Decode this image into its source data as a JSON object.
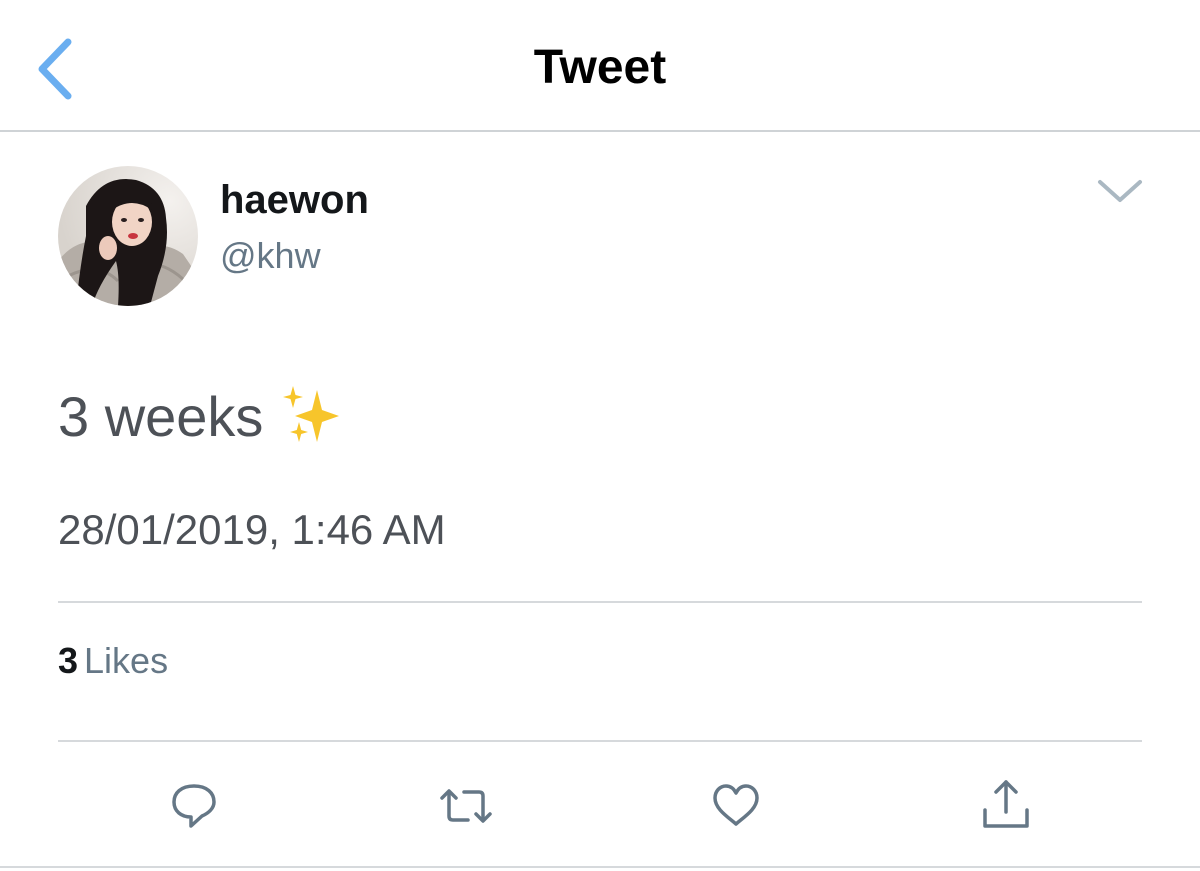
{
  "header": {
    "title": "Tweet",
    "back_icon": "chevron-left-icon"
  },
  "tweet": {
    "display_name": "haewon",
    "handle": "@khw",
    "text": "3 weeks",
    "emoji": "sparkles-icon",
    "timestamp": "28/01/2019, 1:46 AM",
    "likes_count": "3",
    "likes_label": "Likes",
    "menu_icon": "chevron-down-icon"
  },
  "actions": [
    {
      "name": "reply",
      "icon": "speech-bubble-icon"
    },
    {
      "name": "retweet",
      "icon": "retweet-icon"
    },
    {
      "name": "like",
      "icon": "heart-icon"
    },
    {
      "name": "share",
      "icon": "share-icon"
    }
  ],
  "colors": {
    "accent": "#4a90e2",
    "text_primary": "#14171a",
    "text_secondary": "#657786",
    "tweet_text": "#4d5157",
    "icon": "#657786",
    "divider": "#d6d9dc"
  }
}
